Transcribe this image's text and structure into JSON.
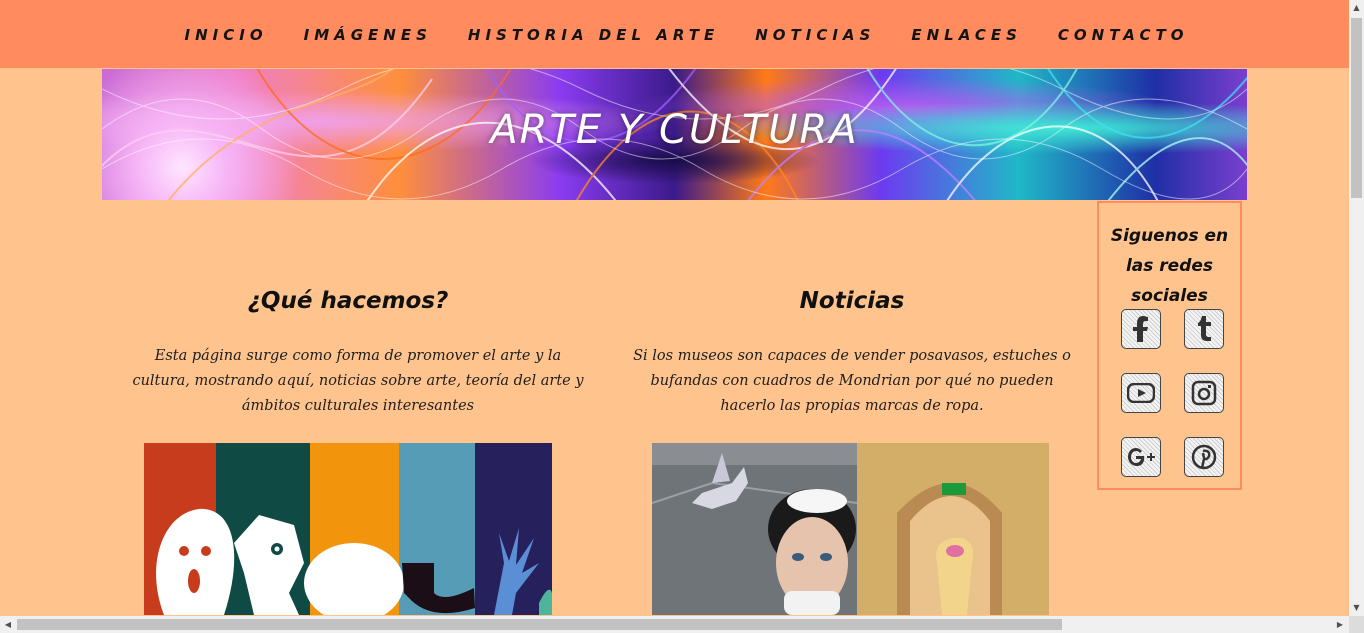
{
  "nav": {
    "items": [
      "INICIO",
      "IMÁGENES",
      "HISTORIA DEL ARTE",
      "NOTICIAS",
      "ENLACES",
      "CONTACTO"
    ]
  },
  "banner": {
    "title": "ARTE Y CULTURA"
  },
  "about": {
    "heading": "¿Qué hacemos?",
    "text": "Esta página surge como forma de promover el arte y la cultura, mostrando aquí, noticias sobre arte, teoría del arte y ámbitos culturales interesantes"
  },
  "news": {
    "heading": "Noticias",
    "text": "Si los museos son capaces de vender posavasos, estuches o bufandas con cuadros de Mondrian por qué no pueden hacerlo las propias marcas de ropa."
  },
  "social": {
    "heading": "Siguenos en las redes sociales",
    "icons": [
      "facebook-icon",
      "tumblr-icon",
      "youtube-icon",
      "instagram-icon",
      "google-plus-icon",
      "pinterest-icon"
    ]
  },
  "colors": {
    "page_bg": "#ffc48e",
    "nav_bg": "#ff8b5f",
    "sidebar_border": "#ff8b5f"
  }
}
